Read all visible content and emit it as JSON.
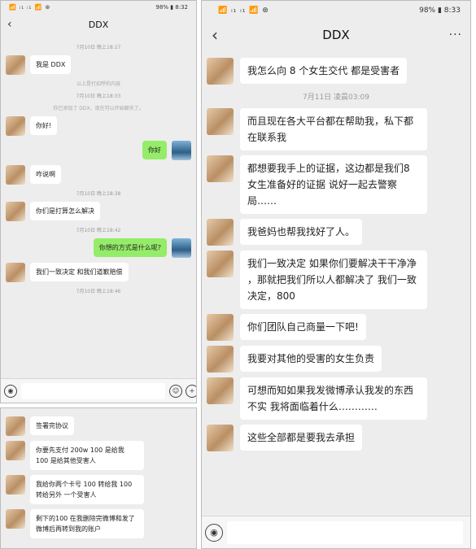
{
  "left_top": {
    "status": {
      "left": "📶 ᵢ₁ ᵢ₁ 📶 ⊛",
      "right": "98% ▮ 8:32"
    },
    "title": "DDX",
    "messages": [
      {
        "kind": "time",
        "text": "7月10日 晚上18:27"
      },
      {
        "kind": "in",
        "text": "我是 DDX"
      },
      {
        "kind": "sys",
        "text": "以上是打招呼的内容"
      },
      {
        "kind": "time",
        "text": "7月10日 晚上18:33"
      },
      {
        "kind": "sys",
        "text": "你已添加了 DDX，现在可以开始聊天了。"
      },
      {
        "kind": "in",
        "text": "你好!"
      },
      {
        "kind": "out",
        "text": "你好"
      },
      {
        "kind": "in",
        "text": "咋说啊"
      },
      {
        "kind": "time",
        "text": "7月10日 晚上18:38"
      },
      {
        "kind": "in",
        "text": "你们是打算怎么解决"
      },
      {
        "kind": "time",
        "text": "7月10日 晚上18:42"
      },
      {
        "kind": "out",
        "text": "你想的方式是什么呢?"
      },
      {
        "kind": "in",
        "text": "我们一致决定 和我们道歉赔偿"
      },
      {
        "kind": "time",
        "text": "7月10日 晚上18:46"
      }
    ]
  },
  "left_bottom": {
    "messages": [
      {
        "kind": "in",
        "text": "签署完协议"
      },
      {
        "kind": "in",
        "text": "你要先支付 200w 100 是给我 100 是给其他受害人"
      },
      {
        "kind": "in",
        "text": "我给你两个卡号  100 转给我  100 转给另外 一个受害人"
      },
      {
        "kind": "in",
        "text": "剩下的100 在我删除完微博和发了微博后再转到我的账户"
      }
    ]
  },
  "right": {
    "status": {
      "left": "📶 ᵢ₁ ᵢ₁ 📶 ⊛",
      "right": "98% ▮ 8:33"
    },
    "title": "DDX",
    "more": "···",
    "messages": [
      {
        "kind": "in",
        "text": "我怎么向 8 个女生交代  都是受害者"
      },
      {
        "kind": "time",
        "text": "7月11日 凌晨03:09"
      },
      {
        "kind": "in",
        "text": "而且现在各大平台都在帮助我，私下都在联系我"
      },
      {
        "kind": "in",
        "text": "都想要我手上的证据，这边都是我们8 女生准备好的证据  说好一起去警察局……"
      },
      {
        "kind": "in",
        "text": "我爸妈也帮我找好了人。"
      },
      {
        "kind": "in",
        "text": "我们一致决定  如果你们要解决干干净净 ，那就把我们所以人都解决了  我们一致决定，800"
      },
      {
        "kind": "in",
        "text": "你们团队自己商量一下吧!"
      },
      {
        "kind": "in",
        "text": "我要对其他的受害的女生负责"
      },
      {
        "kind": "in",
        "text": "可想而知如果我发微博承认我发的东西不实  我将面临着什么…………"
      },
      {
        "kind": "in",
        "text": "这些全部都是要我去承担"
      }
    ]
  },
  "icons": {
    "back": "‹",
    "voice": "◉",
    "emoji": "☺",
    "plus": "+"
  }
}
